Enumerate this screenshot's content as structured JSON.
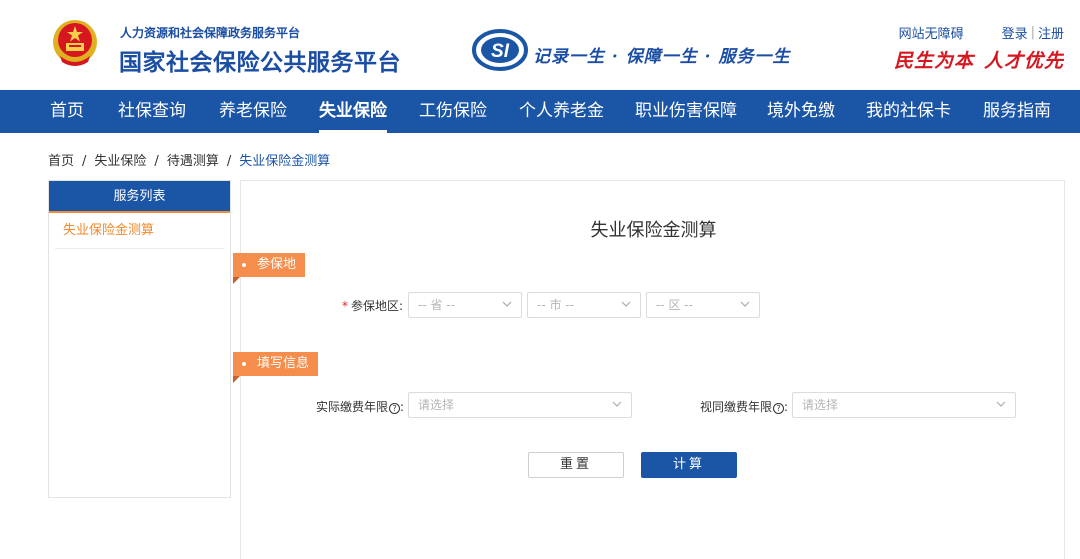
{
  "header": {
    "platform_subtitle": "人力资源和社会保障政务服务平台",
    "platform_title": "国家社会保险公共服务平台",
    "logo_text": "SI",
    "slogan": "记录一生 · 保障一生 · 服务一生",
    "accessibility_link": "网站无障碍",
    "login_link": "登录",
    "register_link": "注册",
    "link_separator": "|",
    "motto_left": "民生为本",
    "motto_right": "人才优先",
    "brand_color": "#1b55a5",
    "motto_color": "#d7171f"
  },
  "nav": {
    "items": [
      {
        "label": "首页"
      },
      {
        "label": "社保查询"
      },
      {
        "label": "养老保险"
      },
      {
        "label": "失业保险"
      },
      {
        "label": "工伤保险"
      },
      {
        "label": "个人养老金"
      },
      {
        "label": "职业伤害保障"
      },
      {
        "label": "境外免缴"
      },
      {
        "label": "我的社保卡"
      },
      {
        "label": "服务指南"
      }
    ],
    "active": "失业保险"
  },
  "breadcrumb": {
    "items": [
      "首页",
      "失业保险",
      "待遇测算"
    ],
    "current": "失业保险金测算",
    "separator": "/"
  },
  "sidebar": {
    "title": "服务列表",
    "items": [
      {
        "label": "失业保险金测算"
      }
    ],
    "accent_color": "#f08a2c"
  },
  "main": {
    "title": "失业保险金测算",
    "section1": {
      "tag": "参保地",
      "field_label": "参保地区:",
      "required_mark": "*",
      "province_placeholder": "-- 省 --",
      "city_placeholder": "-- 市 --",
      "district_placeholder": "-- 区 --"
    },
    "section2": {
      "tag": "填写信息",
      "actual_years_label": "实际缴费年限",
      "actual_years_placeholder": "请选择",
      "deemed_years_label": "视同缴费年限",
      "deemed_years_placeholder": "请选择",
      "help_icon": "?",
      "colon": ":"
    },
    "buttons": {
      "reset": "重置",
      "calculate": "计算"
    },
    "tag_color": "#f58d4d"
  }
}
